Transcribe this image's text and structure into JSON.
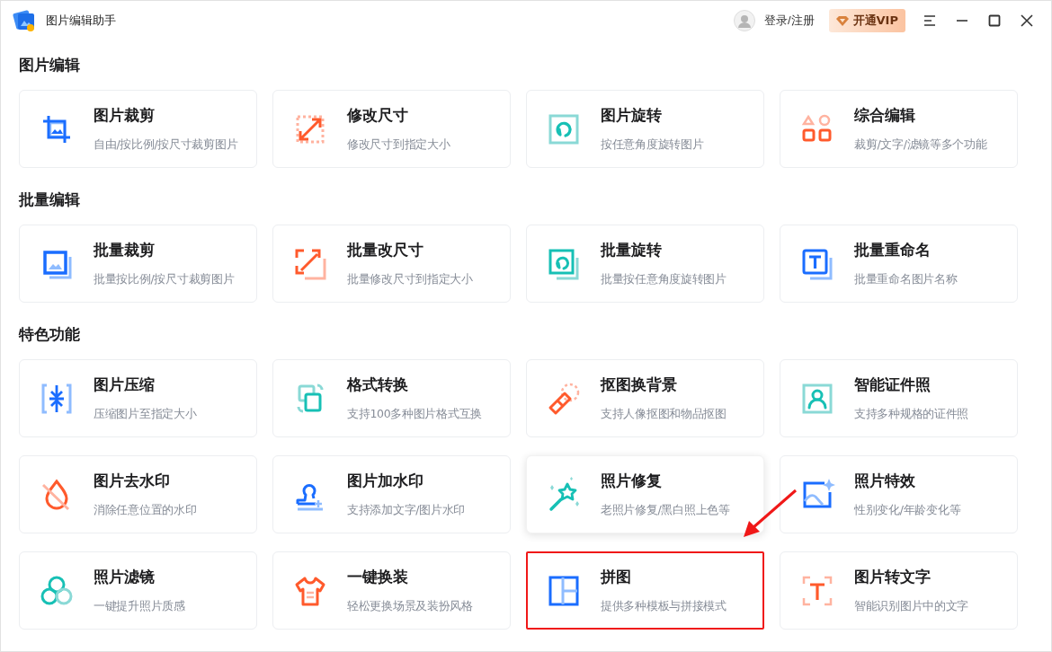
{
  "window": {
    "title": "图片编辑助手"
  },
  "header": {
    "login": "登录/注册",
    "vip_button": "开通VIP"
  },
  "sections": [
    {
      "title": "图片编辑",
      "cards": [
        {
          "title": "图片裁剪",
          "description": "自由/按比例/按尺寸裁剪图片",
          "hovered": false,
          "highlighted": false
        },
        {
          "title": "修改尺寸",
          "description": "修改尺寸到指定大小",
          "hovered": false,
          "highlighted": false
        },
        {
          "title": "图片旋转",
          "description": "按任意角度旋转图片",
          "hovered": false,
          "highlighted": false
        },
        {
          "title": "综合编辑",
          "description": "裁剪/文字/滤镜等多个功能",
          "hovered": false,
          "highlighted": false
        }
      ]
    },
    {
      "title": "批量编辑",
      "cards": [
        {
          "title": "批量裁剪",
          "description": "批量按比例/按尺寸裁剪图片",
          "hovered": false,
          "highlighted": false
        },
        {
          "title": "批量改尺寸",
          "description": "批量修改尺寸到指定大小",
          "hovered": false,
          "highlighted": false
        },
        {
          "title": "批量旋转",
          "description": "批量按任意角度旋转图片",
          "hovered": false,
          "highlighted": false
        },
        {
          "title": "批量重命名",
          "description": "批量重命名图片名称",
          "hovered": false,
          "highlighted": false
        }
      ]
    },
    {
      "title": "特色功能",
      "cards": [
        {
          "title": "图片压缩",
          "description": "压缩图片至指定大小",
          "hovered": false,
          "highlighted": false
        },
        {
          "title": "格式转换",
          "description": "支持100多种图片格式互换",
          "hovered": false,
          "highlighted": false
        },
        {
          "title": "抠图换背景",
          "description": "支持人像抠图和物品抠图",
          "hovered": false,
          "highlighted": false
        },
        {
          "title": "智能证件照",
          "description": "支持多种规格的证件照",
          "hovered": false,
          "highlighted": false
        },
        {
          "title": "图片去水印",
          "description": "消除任意位置的水印",
          "hovered": false,
          "highlighted": false
        },
        {
          "title": "图片加水印",
          "description": "支持添加文字/图片水印",
          "hovered": false,
          "highlighted": false
        },
        {
          "title": "照片修复",
          "description": "老照片修复/黑白照上色等",
          "hovered": true,
          "highlighted": false
        },
        {
          "title": "照片特效",
          "description": "性别变化/年龄变化等",
          "hovered": false,
          "highlighted": false
        },
        {
          "title": "照片滤镜",
          "description": "一键提升照片质感",
          "hovered": false,
          "highlighted": false
        },
        {
          "title": "一键换装",
          "description": "轻松更换场景及装扮风格",
          "hovered": false,
          "highlighted": false
        },
        {
          "title": "拼图",
          "description": "提供多种模板与拼接模式",
          "hovered": false,
          "highlighted": true
        },
        {
          "title": "图片转文字",
          "description": "智能识别图片中的文字",
          "hovered": false,
          "highlighted": false
        }
      ]
    }
  ]
}
